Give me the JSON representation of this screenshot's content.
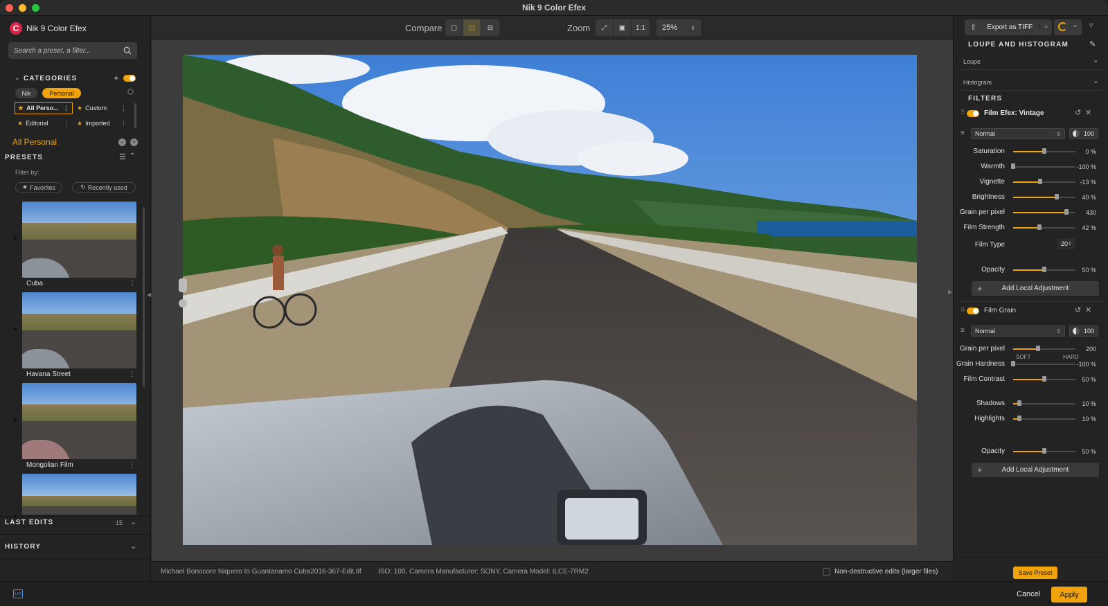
{
  "window": {
    "title": "Nik 9 Color Efex"
  },
  "app": {
    "name": "Nik 9 Color Efex"
  },
  "search": {
    "placeholder": "Search a preset, a filter..."
  },
  "categories": {
    "heading": "CATEGORIES",
    "tabs": [
      {
        "label": "Nik"
      },
      {
        "label": "Personal"
      }
    ],
    "items": [
      {
        "label": "All Perso..."
      },
      {
        "label": "Custom"
      },
      {
        "label": "Editorial"
      },
      {
        "label": "Imported"
      }
    ],
    "current": "All Personal"
  },
  "presets": {
    "heading": "PRESETS",
    "filter_label": "Filter by:",
    "filters": [
      {
        "label": "Favorites"
      },
      {
        "label": "Recently used"
      }
    ],
    "items": [
      {
        "label": "Cuba"
      },
      {
        "label": "Havana Street"
      },
      {
        "label": "Mongolian Film"
      }
    ]
  },
  "last_edits": {
    "heading": "LAST EDITS",
    "count": "15"
  },
  "history": {
    "heading": "HISTORY"
  },
  "toolbar": {
    "compare_label": "Compare",
    "zoom_label": "Zoom",
    "zoom_value": "25%",
    "zoom_one_to_one": "1:1"
  },
  "status": {
    "filename": "Michael Bonocore Niquero to Guantanamo Cuba2016-367-Edit.tif",
    "metadata": "ISO: 100, Camera Manufacturer: SONY, Camera Model: ILCE-7RM2",
    "nondestructive_label": "Non-destructive edits (larger files)"
  },
  "export": {
    "label": "Export as TIFF"
  },
  "loupe_histogram": {
    "heading": "LOUPE AND HISTOGRAM",
    "loupe": "Loupe",
    "histogram": "Histogram"
  },
  "filters": {
    "heading": "FILTERS",
    "film_efex": {
      "name": "Film Efex: Vintage",
      "blend_mode": "Normal",
      "opacity_box": "100",
      "sliders": [
        {
          "label": "Saturation",
          "value": "0 %",
          "level": 0.5
        },
        {
          "label": "Warmth",
          "value": "-100 %",
          "level": 0.0
        },
        {
          "label": "Vignette",
          "value": "-13 %",
          "level": 0.43
        },
        {
          "label": "Brightness",
          "value": "40 %",
          "level": 0.7
        },
        {
          "label": "Grain per pixel",
          "value": "430",
          "level": 0.86
        },
        {
          "label": "Film Strength",
          "value": "42 %",
          "level": 0.42
        }
      ],
      "film_type_label": "Film Type",
      "film_type_value": "20",
      "opacity_label": "Opacity",
      "opacity_value": "50 %",
      "opacity_level": 0.5,
      "add_local": "Add Local Adjustment"
    },
    "film_grain": {
      "name": "Film Grain",
      "blend_mode": "Normal",
      "opacity_box": "100",
      "sliders": [
        {
          "label": "Grain per pixel",
          "value": "200",
          "level": 0.4
        },
        {
          "label": "Grain Hardness",
          "value": "-100 %",
          "level": 0.0
        },
        {
          "label": "Film Contrast",
          "value": "50 %",
          "level": 0.5
        },
        {
          "label": "Shadows",
          "value": "10 %",
          "level": 0.1
        },
        {
          "label": "Highlights",
          "value": "10 %",
          "level": 0.1
        }
      ],
      "soft_label": "SOFT",
      "hard_label": "HARD",
      "opacity_label": "Opacity",
      "opacity_value": "50 %",
      "opacity_level": 0.5,
      "add_local": "Add Local Adjustment"
    }
  },
  "footer": {
    "save_preset": "Save Preset",
    "cancel": "Cancel",
    "apply": "Apply",
    "lrc_badge": "Lrc"
  },
  "colors": {
    "accent": "#f0a30a",
    "background": "#232323",
    "canvas": "#3c3c3c"
  }
}
